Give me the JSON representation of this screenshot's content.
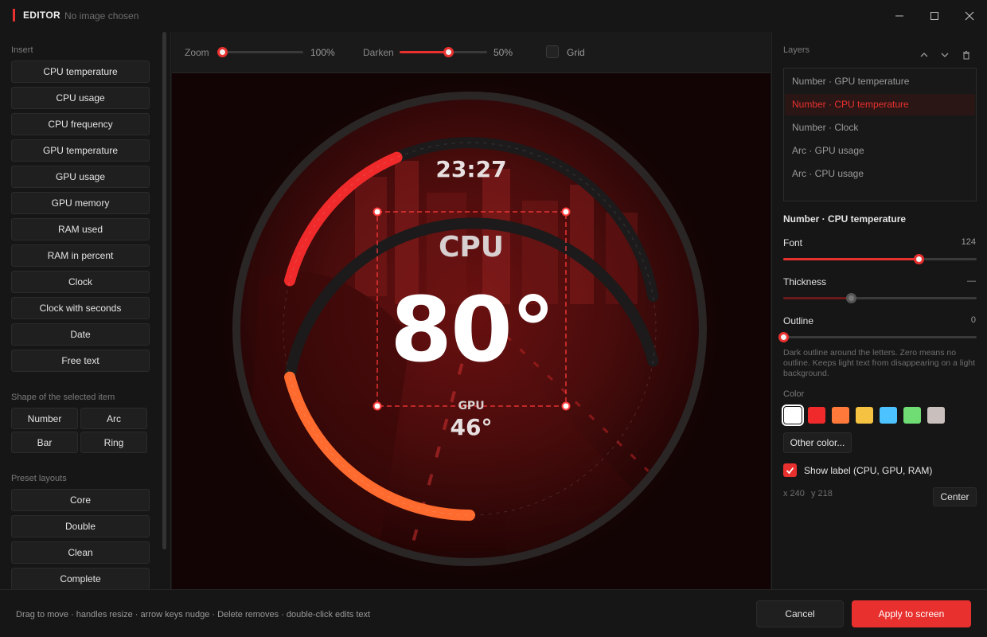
{
  "window": {
    "title": "EDITOR",
    "subtitle": "No image chosen",
    "accent": "#e8312e"
  },
  "sidebar": {
    "insert_label": "Insert",
    "insert_items": [
      "CPU temperature",
      "CPU usage",
      "CPU frequency",
      "GPU temperature",
      "GPU usage",
      "GPU memory",
      "RAM used",
      "RAM in percent",
      "Clock",
      "Clock with seconds",
      "Date",
      "Free text"
    ],
    "shape_label": "Shape of the selected item",
    "shapes": [
      "Number",
      "Arc",
      "Bar",
      "Ring"
    ],
    "preset_label": "Preset layouts",
    "presets": [
      "Core",
      "Double",
      "Clean",
      "Complete"
    ]
  },
  "toolbar": {
    "zoom_label": "Zoom",
    "zoom_value": "100%",
    "zoom_level": 0,
    "darken_label": "Darken",
    "darken_value": "50%",
    "darken_level": 0.55,
    "grid_label": "Grid",
    "grid_on": false
  },
  "canvas": {
    "clock": "23:27",
    "cpu_label": "CPU",
    "cpu_value": "80°",
    "gpu_label": "GPU",
    "gpu_value": "46°",
    "cpu_arc_color": "#f02a2a",
    "gpu_arc_color": "#ff6b2e"
  },
  "layers": {
    "label": "Layers",
    "items": [
      {
        "label": "Number · GPU temperature",
        "selected": false
      },
      {
        "label": "Number · CPU temperature",
        "selected": true
      },
      {
        "label": "Number · Clock",
        "selected": false
      },
      {
        "label": "Arc · GPU usage",
        "selected": false
      },
      {
        "label": "Arc · CPU usage",
        "selected": false
      }
    ]
  },
  "properties": {
    "heading": "Number · CPU temperature",
    "font_label": "Font",
    "font_value": "124",
    "font_level": 0.7,
    "thickness_label": "Thickness",
    "thickness_value": "—",
    "thickness_level": 0.35,
    "outline_label": "Outline",
    "outline_value": "0",
    "outline_level": 0,
    "outline_help": "Dark outline around the letters. Zero means no outline. Keeps light text from disappearing on a light background.",
    "color_label": "Color",
    "colors": [
      "#ffffff",
      "#f02a2a",
      "#ff7a3a",
      "#f5c242",
      "#4cc3ff",
      "#6fdc74",
      "#c9c0bd"
    ],
    "other_color": "Other color...",
    "show_label": "Show label (CPU, GPU, RAM)",
    "show_label_checked": true,
    "pos_x": "x 240",
    "pos_y": "y 218",
    "center_button": "Center"
  },
  "footer": {
    "hint": "Drag to move · handles resize · arrow keys nudge · Delete removes · double-click edits text",
    "cancel": "Cancel",
    "apply": "Apply to screen"
  }
}
